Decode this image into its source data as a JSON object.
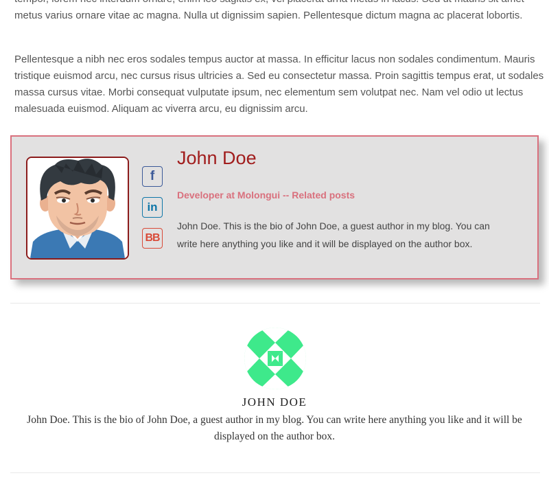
{
  "paragraphs": [
    "tempor, lorem nec interdum ornare, enim leo sagittis ex, vel placerat urna metus in lacus. Sed ut mauris sit amet metus varius ornare vitae ac magna. Nulla ut dignissim sapien. Pellentesque dictum magna ac placerat lobortis.",
    "Pellentesque a nibh nec eros sodales tempus auctor at massa. In efficitur lacus non sodales condimentum. Mauris tristique euismod arcu, nec cursus risus ultricies a. Sed eu consectetur massa. Proin sagittis tempus erat, ut sodales massa cursus vitae. Morbi consequat vulputate ipsum, nec elementum sem volutpat nec. Nam vel odio ut lectus malesuada euismod. Aliquam ac viverra arcu, eu dignissim arcu."
  ],
  "author_box": {
    "name": "John Doe",
    "job": "Developer at Molongui",
    "separator": " -- ",
    "related_link": "Related posts",
    "bio": "John Doe. This is the bio of John Doe, a guest author in my blog. You can write here anything you like and it will be displayed on the author box.",
    "social": {
      "facebook": {
        "glyph": "f",
        "icon": "facebook-icon",
        "color": "#3b5998"
      },
      "linkedin": {
        "glyph": "in",
        "icon": "linkedin-icon",
        "color": "#0e76a8"
      },
      "bb": {
        "glyph": "BB",
        "icon": "bb-icon",
        "color": "#d94a38"
      }
    },
    "colors": {
      "background": "#e2e1e1",
      "border": "#d9707d",
      "name": "#a11d1d",
      "avatar_border": "#8b1a1a"
    }
  },
  "author_box_2": {
    "name": "JOHN DOE",
    "bio": "John Doe. This is the bio of John Doe, a guest author in my blog. You can write here anything you like and it will be displayed on the author box.",
    "logo_color": "#3ee98b"
  }
}
